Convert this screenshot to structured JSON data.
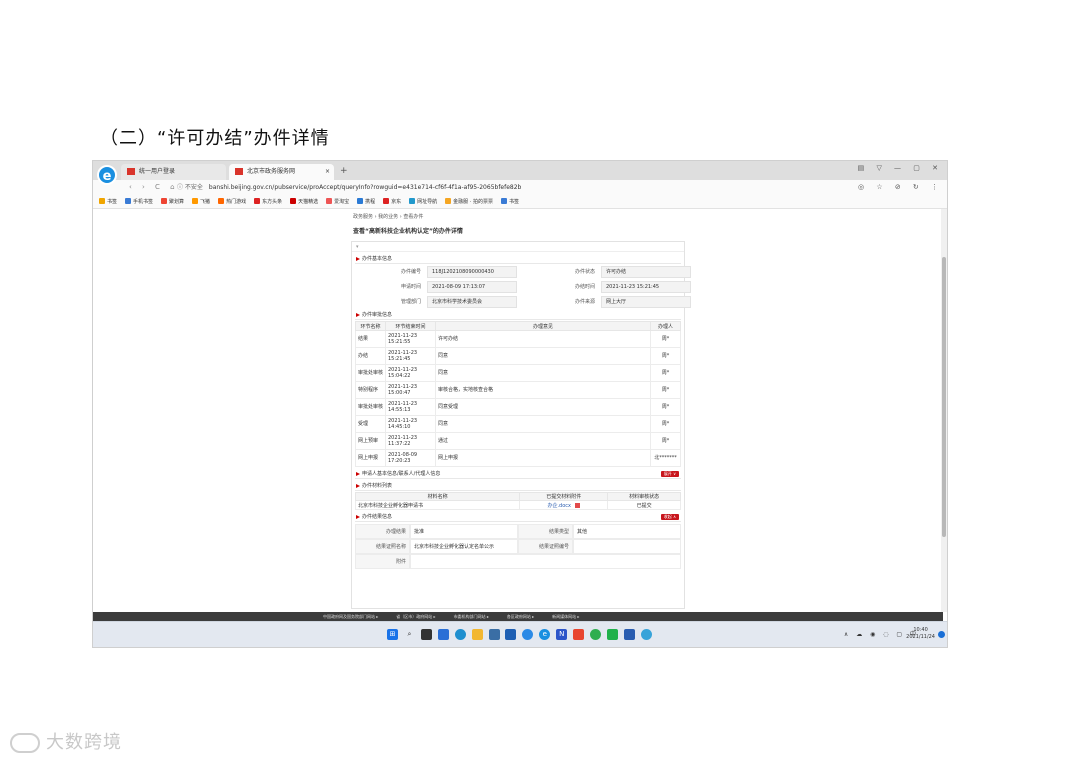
{
  "heading": "（二）“许可办结”办件详情",
  "browser": {
    "tabs": [
      {
        "label": "统一用户登录",
        "active": false
      },
      {
        "label": "北京市政务服务网",
        "active": true
      }
    ],
    "new_tab": "+",
    "window_controls": "▤ ▽ — ▢ ✕",
    "security": "ⓘ 不安全",
    "url": "banshi.beijing.gov.cn/pubservice/proAccept/queryInfo?rowguid=e431e714-cf6f-4f1a-af95-2065bfefe82b",
    "nav": "‹ › C ⌂",
    "addr_right": "◎ ☆ ⊘ ↻ ⋮",
    "bookmarks": [
      {
        "label": "书签",
        "color": "#f0a500"
      },
      {
        "label": "手机书签",
        "color": "#3a7bd5"
      },
      {
        "label": "聚划算",
        "color": "#e43"
      },
      {
        "label": "飞猪",
        "color": "#f90"
      },
      {
        "label": "热门游戏",
        "color": "#f60"
      },
      {
        "label": "东方头条",
        "color": "#d22"
      },
      {
        "label": "天猫精选",
        "color": "#c00"
      },
      {
        "label": "爱淘宝",
        "color": "#e55"
      },
      {
        "label": "携程",
        "color": "#2a7ad5"
      },
      {
        "label": "京东",
        "color": "#d22"
      },
      {
        "label": "网址导航",
        "color": "#29c"
      },
      {
        "label": "金融服 · 拍的票票",
        "color": "#f5a623"
      },
      {
        "label": "书签",
        "color": "#3a7bd5"
      }
    ]
  },
  "page": {
    "breadcrumb": "政务服务 › 我的业务 › 查看办件",
    "title": "查看“高新科技企业机构认定”的办件详情",
    "panel_top": "▾",
    "basic_section": "办件基本信息",
    "basic_info": [
      {
        "k1": "办件编号",
        "v1": "118J1202108090000430",
        "k2": "办件状态",
        "v2": "许可办结"
      },
      {
        "k1": "申请时间",
        "v1": "2021-08-09 17:13:07",
        "k2": "办结时间",
        "v2": "2021-11-23 15:21:45"
      },
      {
        "k1": "管理部门",
        "v1": "北京市科学技术委员会",
        "k2": "办件来源",
        "v2": "网上大厅"
      }
    ],
    "audit_section": "办件审批信息",
    "audit_headers": [
      "环节名称",
      "环节结束时间",
      "办理意见",
      "办理人"
    ],
    "audit_rows": [
      {
        "step": "结果",
        "time": "2021-11-23 15:21:55",
        "opinion": "许可办结",
        "person": "周*"
      },
      {
        "step": "办结",
        "time": "2021-11-23 15:21:45",
        "opinion": "同意",
        "person": "周*"
      },
      {
        "step": "审批处审核",
        "time": "2021-11-23 15:04:22",
        "opinion": "同意",
        "person": "周*"
      },
      {
        "step": "特别程序",
        "time": "2021-11-23 15:00:47",
        "opinion": "审核合格，实地核查合格",
        "person": "周*"
      },
      {
        "step": "审批处审核",
        "time": "2021-11-23 14:55:13",
        "opinion": "同意受理",
        "person": "周*"
      },
      {
        "step": "受理",
        "time": "2021-11-23 14:45:10",
        "opinion": "同意",
        "person": "周*"
      },
      {
        "step": "网上预审",
        "time": "2021-11-23 11:37:22",
        "opinion": "通过",
        "person": "周*"
      },
      {
        "step": "网上申报",
        "time": "2021-08-09 17:20:23",
        "opinion": "网上申报",
        "person": "北*******"
      }
    ],
    "applicant_section": "申请人基本信息/联系人/代理人信息",
    "applicant_toggle": "展开 ∨",
    "materials_section": "办件材料列表",
    "materials_headers": [
      "材料名称",
      "已提交材料附件",
      "材料审核状态"
    ],
    "materials_rows": [
      {
        "name": "北京市科技企业孵化器申请书",
        "file": "办企.docx",
        "status": "已提交"
      }
    ],
    "result_section": "办件结果信息",
    "result_toggle": "收起 ∧",
    "result_info": [
      {
        "k1": "办理结果",
        "v1": "批准",
        "k2": "结果类型",
        "v2": "其他"
      },
      {
        "k1": "结果证照名称",
        "v1": "北京市科技企业孵化器认定名单公示",
        "k2": "结果证照编号",
        "v2": ""
      },
      {
        "k1": "附件",
        "v1": "",
        "k2": "",
        "v2": ""
      }
    ]
  },
  "footer_links": [
    "中国政府网及国务院部门网站 ▸",
    "省（区市）政府网站 ▸",
    "市委机构部门网站 ▸",
    "各区政府网站 ▸",
    "新闻媒体网站 ▸"
  ],
  "taskbar": {
    "tray": "∧ ☁ ◉ ◌ ▢ 中",
    "time": "10:40",
    "date": "2021/11/24"
  },
  "watermark": "大数跨境"
}
